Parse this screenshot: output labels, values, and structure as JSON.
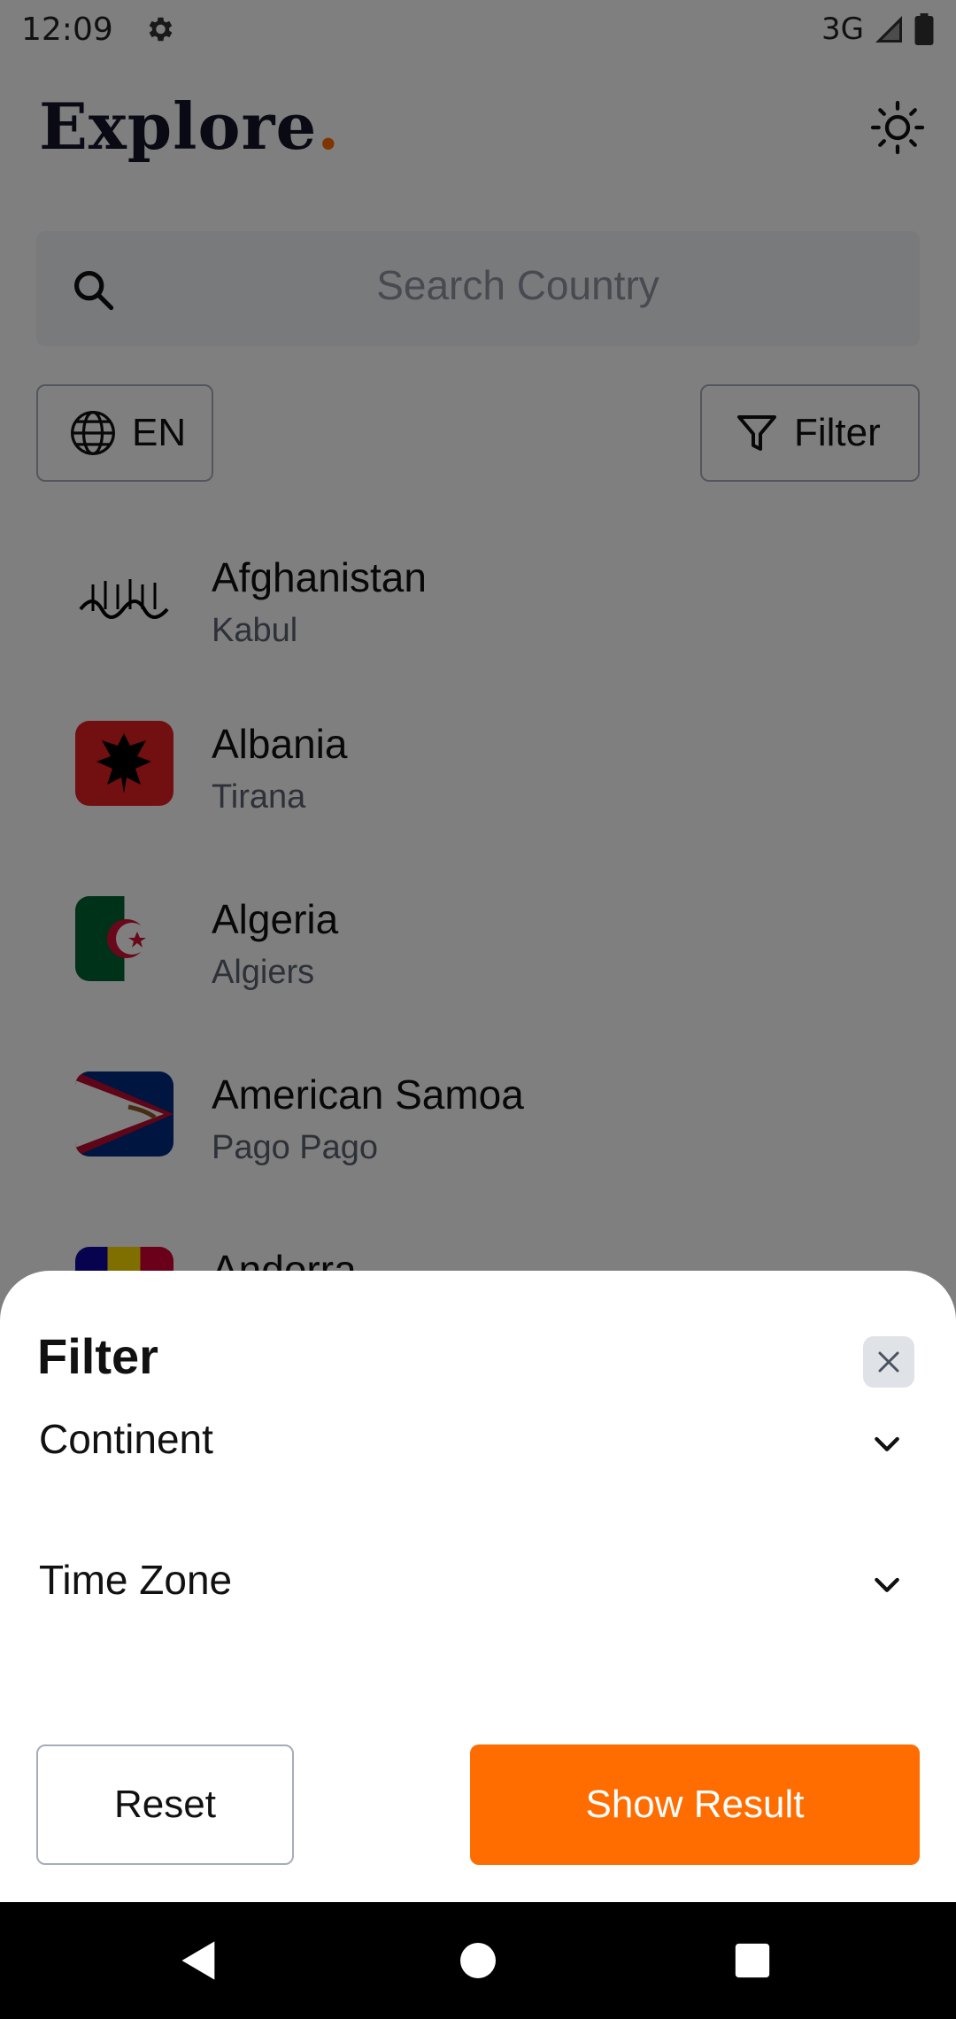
{
  "status_bar": {
    "time": "12:09",
    "network": "3G",
    "icons": [
      "gear-icon",
      "signal-icon",
      "battery-icon"
    ]
  },
  "header": {
    "title": "Explore",
    "title_dot": ".",
    "theme_icon": "sun-icon"
  },
  "search": {
    "placeholder": "Search Country",
    "icon": "search-icon"
  },
  "controls": {
    "language_label": "EN",
    "language_icon": "globe-icon",
    "filter_label": "Filter",
    "filter_icon": "funnel-icon"
  },
  "countries": [
    {
      "name": "Afghanistan",
      "capital": "Kabul"
    },
    {
      "name": "Albania",
      "capital": "Tirana"
    },
    {
      "name": "Algeria",
      "capital": "Algiers"
    },
    {
      "name": "American Samoa",
      "capital": "Pago Pago"
    },
    {
      "name": "Andorra",
      "capital": ""
    }
  ],
  "filter_sheet": {
    "title": "Filter",
    "close_icon": "close-icon",
    "sections": [
      {
        "label": "Continent",
        "icon": "chevron-down-icon"
      },
      {
        "label": "Time Zone",
        "icon": "chevron-down-icon"
      }
    ],
    "reset_label": "Reset",
    "show_result_label": "Show Result"
  },
  "colors": {
    "accent": "#ff6d00",
    "title_color": "#14142b",
    "muted_text": "#5b6270",
    "scrim": "rgba(0,0,0,0.5)"
  },
  "nav_bar": {
    "buttons": [
      "back-icon",
      "home-icon",
      "recents-icon"
    ]
  }
}
